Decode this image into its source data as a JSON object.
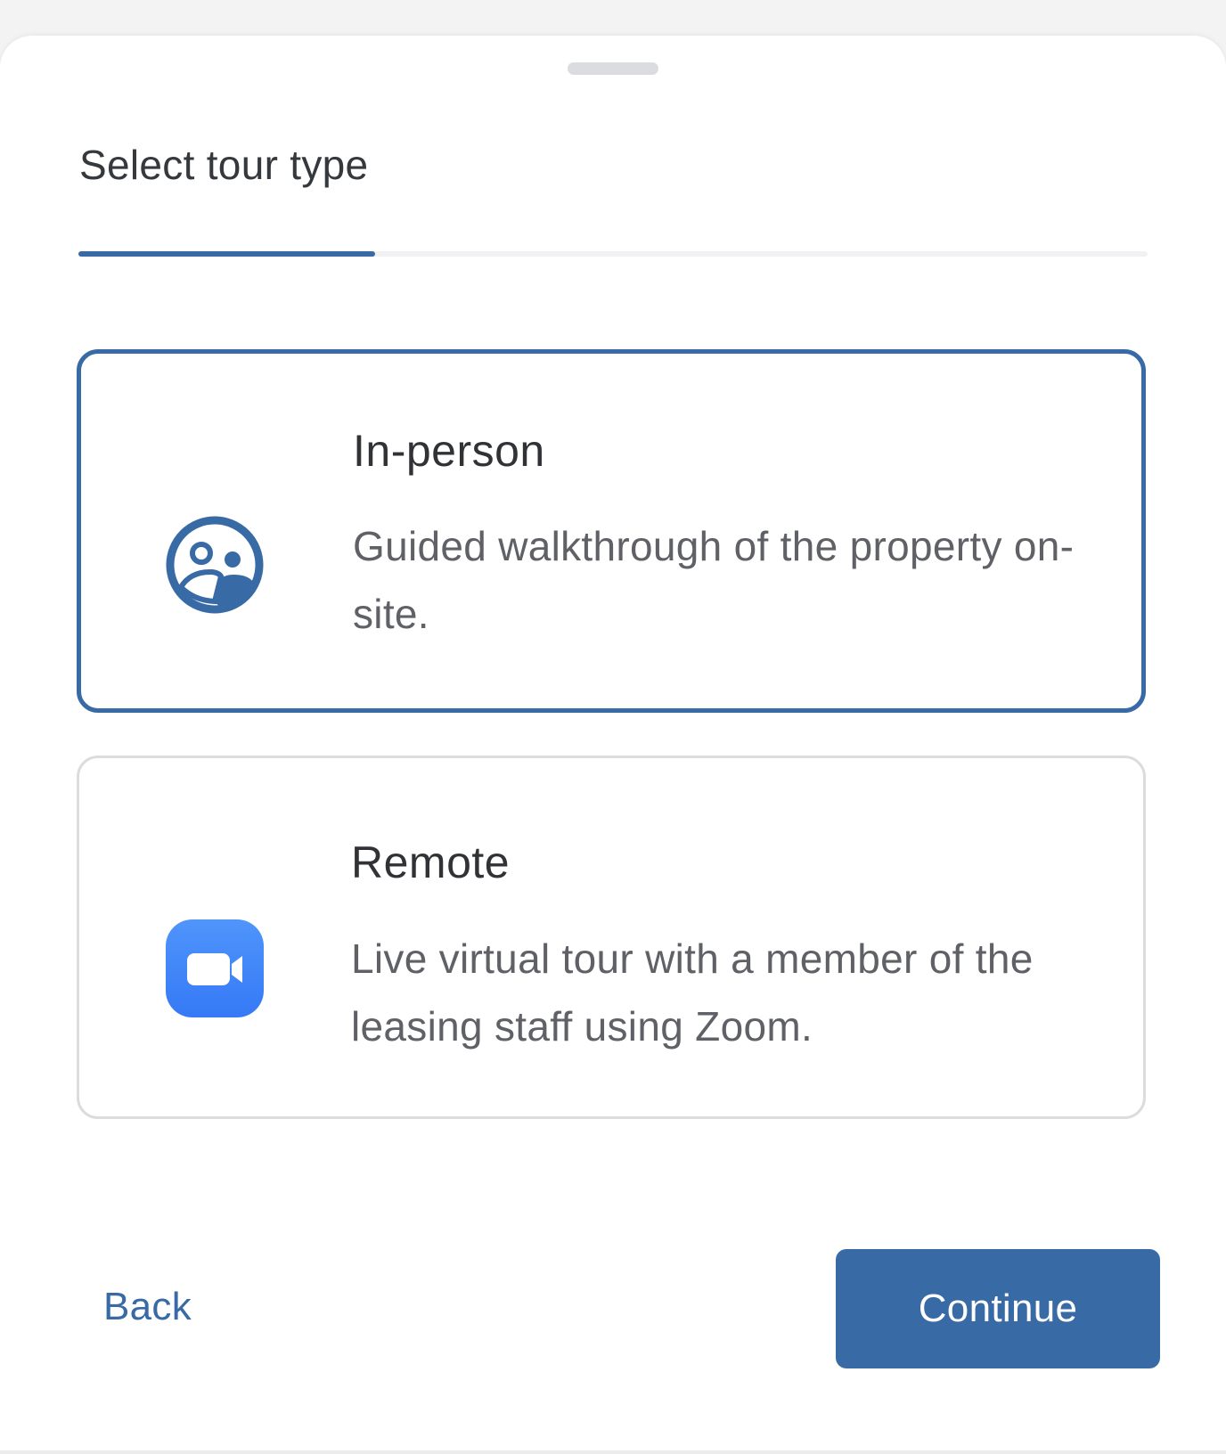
{
  "header": {
    "title": "Select tour type"
  },
  "progress": {
    "fraction": 0.2778,
    "color": "#3a6aa6"
  },
  "options": [
    {
      "title": "In-person",
      "description": "Guided walkthrough of the property on-site.",
      "icon": "in-person-tour-icon",
      "selected": true
    },
    {
      "title": "Remote",
      "description": "Live virtual tour with a member of the leasing staff using Zoom.",
      "icon": "zoom-video-icon",
      "selected": false
    }
  ],
  "footer": {
    "back_label": "Back",
    "continue_label": "Continue"
  },
  "colors": {
    "accent": "#386aa5",
    "zoom_blue": "#3b86fb"
  }
}
